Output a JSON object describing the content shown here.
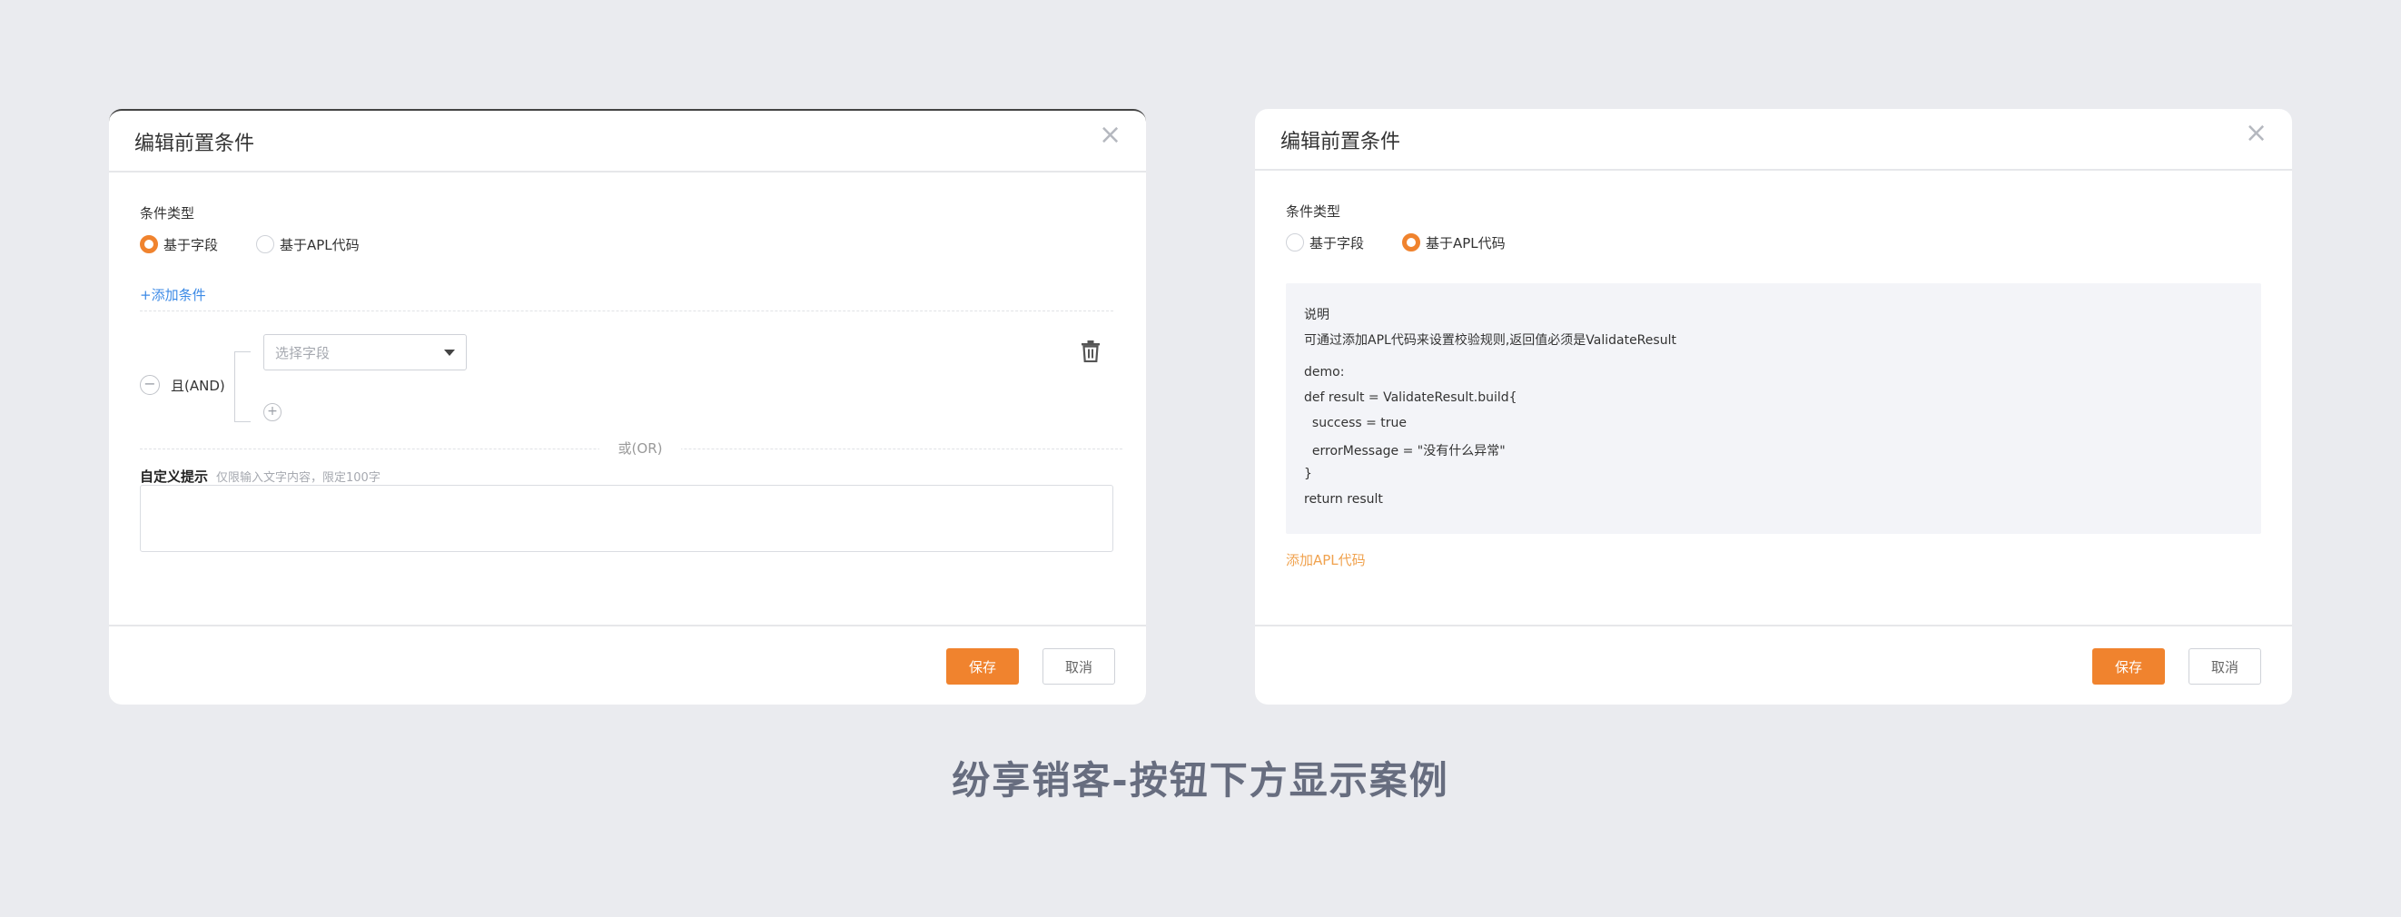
{
  "left_dialog": {
    "title": "编辑前置条件",
    "condition_type_label": "条件类型",
    "radio_field_label": "基于字段",
    "radio_apl_label": "基于APL代码",
    "selected": "基于字段",
    "add_condition_link": "+添加条件",
    "and_label": "且(AND)",
    "field_select_placeholder": "选择字段",
    "or_label": "或(OR)",
    "custom_tip_label": "自定义提示",
    "custom_tip_hint": "仅限输入文字内容，限定100字",
    "custom_tip_value": "",
    "save_label": "保存",
    "cancel_label": "取消"
  },
  "right_dialog": {
    "title": "编辑前置条件",
    "condition_type_label": "条件类型",
    "radio_field_label": "基于字段",
    "radio_apl_label": "基于APL代码",
    "selected": "基于APL代码",
    "info": {
      "heading": "说明",
      "description": "可通过添加APL代码来设置校验规则,返回值必须是ValidateResult",
      "code_lines": [
        "demo:",
        "def result = ValidateResult.build{",
        "  success = true",
        "  errorMessage = \"没有什么异常\"",
        "}",
        "return result"
      ]
    },
    "add_apl_link": "添加APL代码",
    "save_label": "保存",
    "cancel_label": "取消"
  },
  "caption": "纷享销客-按钮下方显示案例",
  "colors": {
    "accent_orange": "#f0832e",
    "link_blue": "#3c8ae6",
    "link_orange": "#f0a24e",
    "background": "#eaebef"
  },
  "icons": {
    "close": "close-icon",
    "trash": "trash-icon",
    "minus": "minus-circle-icon",
    "plus": "plus-circle-icon",
    "caret": "caret-down-icon"
  }
}
